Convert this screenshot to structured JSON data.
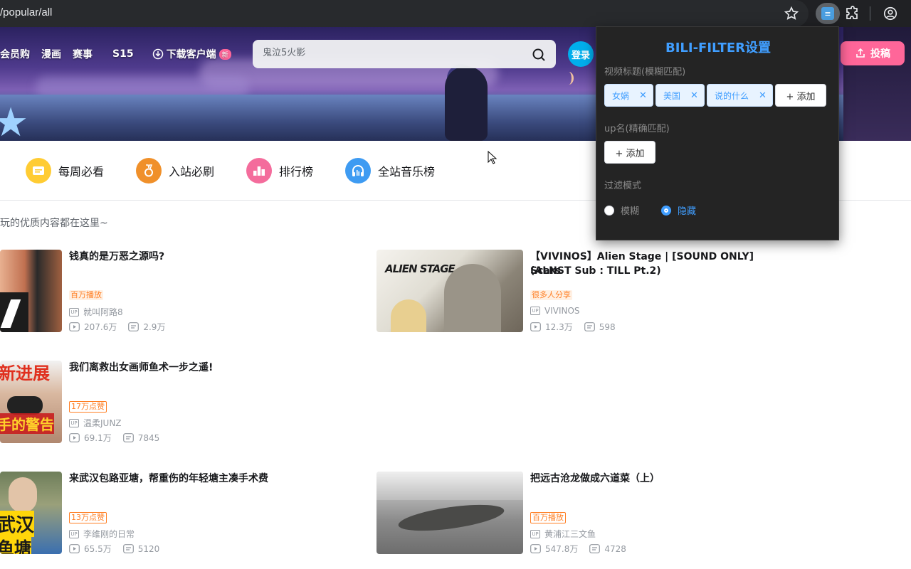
{
  "browser": {
    "url": "/popular/all"
  },
  "header": {
    "nav": [
      "会员购",
      "漫画",
      "赛事",
      "S15"
    ],
    "download_label": "下载客户端",
    "new_badge": "新",
    "search_placeholder": "鬼泣5火影",
    "login_label": "登录",
    "upload_label": "投稿"
  },
  "categories": [
    {
      "label": "每周必看",
      "color": "#ffcc33"
    },
    {
      "label": "入站必刷",
      "color": "#f0902a"
    },
    {
      "label": "排行榜",
      "color": "#f46c9c"
    },
    {
      "label": "全站音乐榜",
      "color": "#3e9bf2"
    }
  ],
  "subtitle": "玩的优质内容都在这里~",
  "videos": [
    {
      "title": "钱真的是万恶之源吗?",
      "tag": "百万播放",
      "up": "就叫阿路8",
      "views": "207.6万",
      "danmaku": "2.9万"
    },
    {
      "title": "【VIVINOS】Alien Stage | [SOUND ONLY] Scars",
      "title2": "(ALNST Sub : TILL Pt.2)",
      "tag": "很多人分享",
      "up": "VIVINOS",
      "views": "12.3万",
      "danmaku": "598"
    },
    {
      "title": "我们离救出女画师鱼术一步之遥!",
      "tag": "17万点赞",
      "up": "温柔JUNZ",
      "views": "69.1万",
      "danmaku": "7845"
    },
    {
      "title": "来武汉包路亚塘，帮重伤的年轻塘主凑手术费",
      "tag": "13万点赞",
      "up": "李维刚的日常",
      "views": "65.5万",
      "danmaku": "5120"
    },
    {
      "title": "把远古沧龙做成六道菜（上）",
      "tag": "百万播放",
      "up": "黄浦江三文鱼",
      "views": "547.8万",
      "danmaku": "4728"
    }
  ],
  "thumb_text": {
    "v3": "新进展",
    "v3b": "手的警告",
    "v4": "武汉",
    "v4b": "鱼塘",
    "v2": "ALIEN STAGE"
  },
  "filter_popup": {
    "title": "BILI-FILTER设置",
    "title_label": "视频标题(模糊匹配)",
    "title_keywords": [
      "女娲",
      "美国",
      "说的什么"
    ],
    "add_label": "+ 添加",
    "up_label": "up名(精确匹配)",
    "mode_label": "过滤模式",
    "mode_options": [
      "模糊",
      "隐藏"
    ],
    "mode_selected": "隐藏"
  }
}
